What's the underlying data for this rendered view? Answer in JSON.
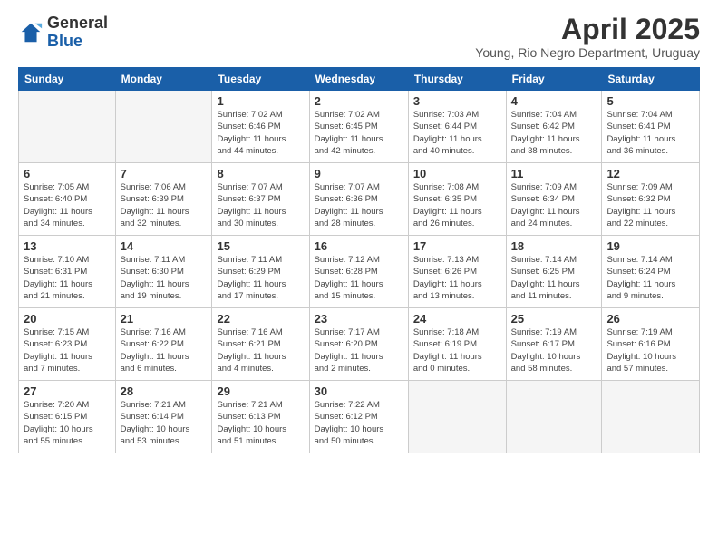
{
  "header": {
    "logo_general": "General",
    "logo_blue": "Blue",
    "month": "April 2025",
    "location": "Young, Rio Negro Department, Uruguay"
  },
  "weekdays": [
    "Sunday",
    "Monday",
    "Tuesday",
    "Wednesday",
    "Thursday",
    "Friday",
    "Saturday"
  ],
  "weeks": [
    [
      {
        "day": "",
        "sunrise": "",
        "sunset": "",
        "daylight": ""
      },
      {
        "day": "",
        "sunrise": "",
        "sunset": "",
        "daylight": ""
      },
      {
        "day": "1",
        "sunrise": "Sunrise: 7:02 AM",
        "sunset": "Sunset: 6:46 PM",
        "daylight": "Daylight: 11 hours and 44 minutes."
      },
      {
        "day": "2",
        "sunrise": "Sunrise: 7:02 AM",
        "sunset": "Sunset: 6:45 PM",
        "daylight": "Daylight: 11 hours and 42 minutes."
      },
      {
        "day": "3",
        "sunrise": "Sunrise: 7:03 AM",
        "sunset": "Sunset: 6:44 PM",
        "daylight": "Daylight: 11 hours and 40 minutes."
      },
      {
        "day": "4",
        "sunrise": "Sunrise: 7:04 AM",
        "sunset": "Sunset: 6:42 PM",
        "daylight": "Daylight: 11 hours and 38 minutes."
      },
      {
        "day": "5",
        "sunrise": "Sunrise: 7:04 AM",
        "sunset": "Sunset: 6:41 PM",
        "daylight": "Daylight: 11 hours and 36 minutes."
      }
    ],
    [
      {
        "day": "6",
        "sunrise": "Sunrise: 7:05 AM",
        "sunset": "Sunset: 6:40 PM",
        "daylight": "Daylight: 11 hours and 34 minutes."
      },
      {
        "day": "7",
        "sunrise": "Sunrise: 7:06 AM",
        "sunset": "Sunset: 6:39 PM",
        "daylight": "Daylight: 11 hours and 32 minutes."
      },
      {
        "day": "8",
        "sunrise": "Sunrise: 7:07 AM",
        "sunset": "Sunset: 6:37 PM",
        "daylight": "Daylight: 11 hours and 30 minutes."
      },
      {
        "day": "9",
        "sunrise": "Sunrise: 7:07 AM",
        "sunset": "Sunset: 6:36 PM",
        "daylight": "Daylight: 11 hours and 28 minutes."
      },
      {
        "day": "10",
        "sunrise": "Sunrise: 7:08 AM",
        "sunset": "Sunset: 6:35 PM",
        "daylight": "Daylight: 11 hours and 26 minutes."
      },
      {
        "day": "11",
        "sunrise": "Sunrise: 7:09 AM",
        "sunset": "Sunset: 6:34 PM",
        "daylight": "Daylight: 11 hours and 24 minutes."
      },
      {
        "day": "12",
        "sunrise": "Sunrise: 7:09 AM",
        "sunset": "Sunset: 6:32 PM",
        "daylight": "Daylight: 11 hours and 22 minutes."
      }
    ],
    [
      {
        "day": "13",
        "sunrise": "Sunrise: 7:10 AM",
        "sunset": "Sunset: 6:31 PM",
        "daylight": "Daylight: 11 hours and 21 minutes."
      },
      {
        "day": "14",
        "sunrise": "Sunrise: 7:11 AM",
        "sunset": "Sunset: 6:30 PM",
        "daylight": "Daylight: 11 hours and 19 minutes."
      },
      {
        "day": "15",
        "sunrise": "Sunrise: 7:11 AM",
        "sunset": "Sunset: 6:29 PM",
        "daylight": "Daylight: 11 hours and 17 minutes."
      },
      {
        "day": "16",
        "sunrise": "Sunrise: 7:12 AM",
        "sunset": "Sunset: 6:28 PM",
        "daylight": "Daylight: 11 hours and 15 minutes."
      },
      {
        "day": "17",
        "sunrise": "Sunrise: 7:13 AM",
        "sunset": "Sunset: 6:26 PM",
        "daylight": "Daylight: 11 hours and 13 minutes."
      },
      {
        "day": "18",
        "sunrise": "Sunrise: 7:14 AM",
        "sunset": "Sunset: 6:25 PM",
        "daylight": "Daylight: 11 hours and 11 minutes."
      },
      {
        "day": "19",
        "sunrise": "Sunrise: 7:14 AM",
        "sunset": "Sunset: 6:24 PM",
        "daylight": "Daylight: 11 hours and 9 minutes."
      }
    ],
    [
      {
        "day": "20",
        "sunrise": "Sunrise: 7:15 AM",
        "sunset": "Sunset: 6:23 PM",
        "daylight": "Daylight: 11 hours and 7 minutes."
      },
      {
        "day": "21",
        "sunrise": "Sunrise: 7:16 AM",
        "sunset": "Sunset: 6:22 PM",
        "daylight": "Daylight: 11 hours and 6 minutes."
      },
      {
        "day": "22",
        "sunrise": "Sunrise: 7:16 AM",
        "sunset": "Sunset: 6:21 PM",
        "daylight": "Daylight: 11 hours and 4 minutes."
      },
      {
        "day": "23",
        "sunrise": "Sunrise: 7:17 AM",
        "sunset": "Sunset: 6:20 PM",
        "daylight": "Daylight: 11 hours and 2 minutes."
      },
      {
        "day": "24",
        "sunrise": "Sunrise: 7:18 AM",
        "sunset": "Sunset: 6:19 PM",
        "daylight": "Daylight: 11 hours and 0 minutes."
      },
      {
        "day": "25",
        "sunrise": "Sunrise: 7:19 AM",
        "sunset": "Sunset: 6:17 PM",
        "daylight": "Daylight: 10 hours and 58 minutes."
      },
      {
        "day": "26",
        "sunrise": "Sunrise: 7:19 AM",
        "sunset": "Sunset: 6:16 PM",
        "daylight": "Daylight: 10 hours and 57 minutes."
      }
    ],
    [
      {
        "day": "27",
        "sunrise": "Sunrise: 7:20 AM",
        "sunset": "Sunset: 6:15 PM",
        "daylight": "Daylight: 10 hours and 55 minutes."
      },
      {
        "day": "28",
        "sunrise": "Sunrise: 7:21 AM",
        "sunset": "Sunset: 6:14 PM",
        "daylight": "Daylight: 10 hours and 53 minutes."
      },
      {
        "day": "29",
        "sunrise": "Sunrise: 7:21 AM",
        "sunset": "Sunset: 6:13 PM",
        "daylight": "Daylight: 10 hours and 51 minutes."
      },
      {
        "day": "30",
        "sunrise": "Sunrise: 7:22 AM",
        "sunset": "Sunset: 6:12 PM",
        "daylight": "Daylight: 10 hours and 50 minutes."
      },
      {
        "day": "",
        "sunrise": "",
        "sunset": "",
        "daylight": ""
      },
      {
        "day": "",
        "sunrise": "",
        "sunset": "",
        "daylight": ""
      },
      {
        "day": "",
        "sunrise": "",
        "sunset": "",
        "daylight": ""
      }
    ]
  ]
}
